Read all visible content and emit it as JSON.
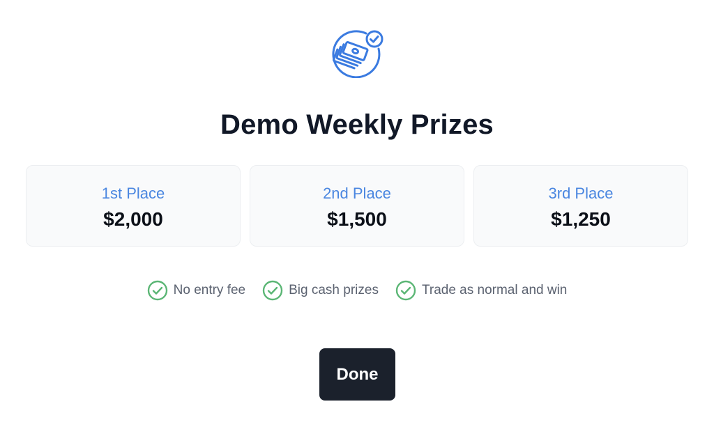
{
  "header": {
    "icon": "money-stack-check-icon",
    "title": "Demo Weekly Prizes"
  },
  "prizes": [
    {
      "place": "1st Place",
      "amount": "$2,000"
    },
    {
      "place": "2nd Place",
      "amount": "$1,500"
    },
    {
      "place": "3rd Place",
      "amount": "$1,250"
    }
  ],
  "features": [
    {
      "icon": "check-circle-icon",
      "label": "No entry fee"
    },
    {
      "icon": "check-circle-icon",
      "label": "Big cash prizes"
    },
    {
      "icon": "check-circle-icon",
      "label": "Trade as normal and win"
    }
  ],
  "actions": {
    "done_label": "Done"
  },
  "colors": {
    "accent_blue": "#3b7be0",
    "check_green": "#5bb675",
    "title_text": "#111827",
    "button_bg": "#1b212c",
    "card_bg": "#f9fafb"
  }
}
